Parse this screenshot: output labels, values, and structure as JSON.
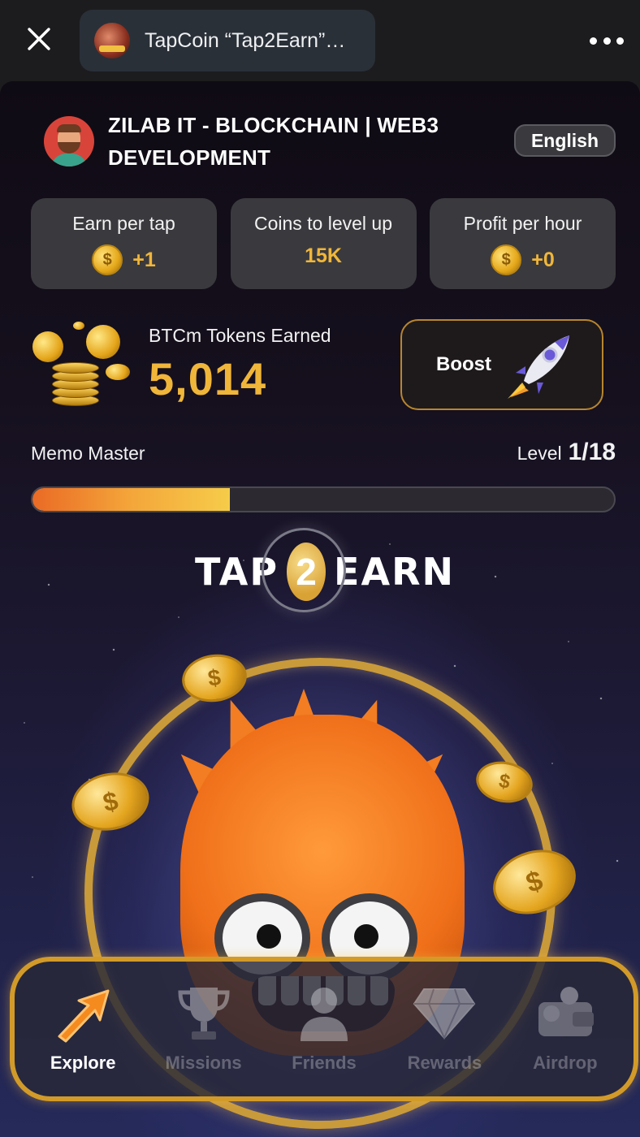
{
  "browser": {
    "tab_title": "TapCoin “Tap2Earn”…"
  },
  "profile": {
    "name": "ZILAB IT - BLOCKCHAIN | WEB3 DEVELOPMENT",
    "language": "English"
  },
  "stats": [
    {
      "label": "Earn per tap",
      "value": "+1",
      "icon": "coin-icon"
    },
    {
      "label": "Coins to level up",
      "value": "15K"
    },
    {
      "label": "Profit per hour",
      "value": "+0",
      "icon": "coin-icon"
    }
  ],
  "tokens": {
    "label": "BTCm Tokens Earned",
    "value": "5,014"
  },
  "boost": {
    "label": "Boost",
    "icon": "rocket-icon"
  },
  "level": {
    "name": "Memo Master",
    "label": "Level",
    "value": "1/18",
    "progress_fraction": 0.34
  },
  "logo": {
    "word_left": "TAP",
    "number": "2",
    "word_right": "EARN"
  },
  "nav": [
    {
      "label": "Explore",
      "icon": "explore-arrow-icon",
      "active": true
    },
    {
      "label": "Missions",
      "icon": "trophy-icon",
      "active": false
    },
    {
      "label": "Friends",
      "icon": "user-icon",
      "active": false
    },
    {
      "label": "Rewards",
      "icon": "diamond-icon",
      "active": false
    },
    {
      "label": "Airdrop",
      "icon": "wallet-icon",
      "active": false
    }
  ],
  "colors": {
    "accent_gold": "#f0b63a",
    "card_bg": "#3a3a3e",
    "nav_border": "#d29a28",
    "progress_start": "#ea6a25",
    "progress_end": "#f6cc4a"
  }
}
